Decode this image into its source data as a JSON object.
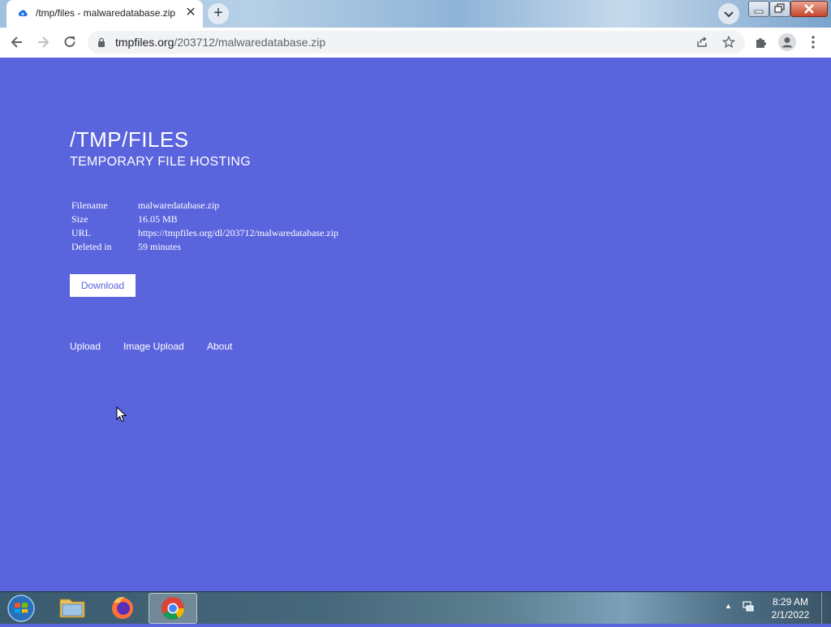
{
  "browser": {
    "tab_title": "/tmp/files - malwaredatabase.zip",
    "tab_close": "✕",
    "new_tab": "+",
    "url_host": "tmpfiles.org",
    "url_path": "/203712/malwaredatabase.zip"
  },
  "site": {
    "title": "/TMP/FILES",
    "subtitle": "TEMPORARY FILE HOSTING"
  },
  "file_info": [
    {
      "label": "Filename",
      "value": "malwaredatabase.zip"
    },
    {
      "label": "Size",
      "value": "16.05 MB"
    },
    {
      "label": "URL",
      "value": "https://tmpfiles.org/dl/203712/malwaredatabase.zip"
    },
    {
      "label": "Deleted in",
      "value": "59 minutes"
    }
  ],
  "download_label": "Download",
  "footer_links": [
    "Upload",
    "Image Upload",
    "About"
  ],
  "taskbar": {
    "time": "8:29 AM",
    "date": "2/1/2022"
  },
  "colors": {
    "page_bg": "#5a64dd",
    "text": "#ffffff"
  }
}
